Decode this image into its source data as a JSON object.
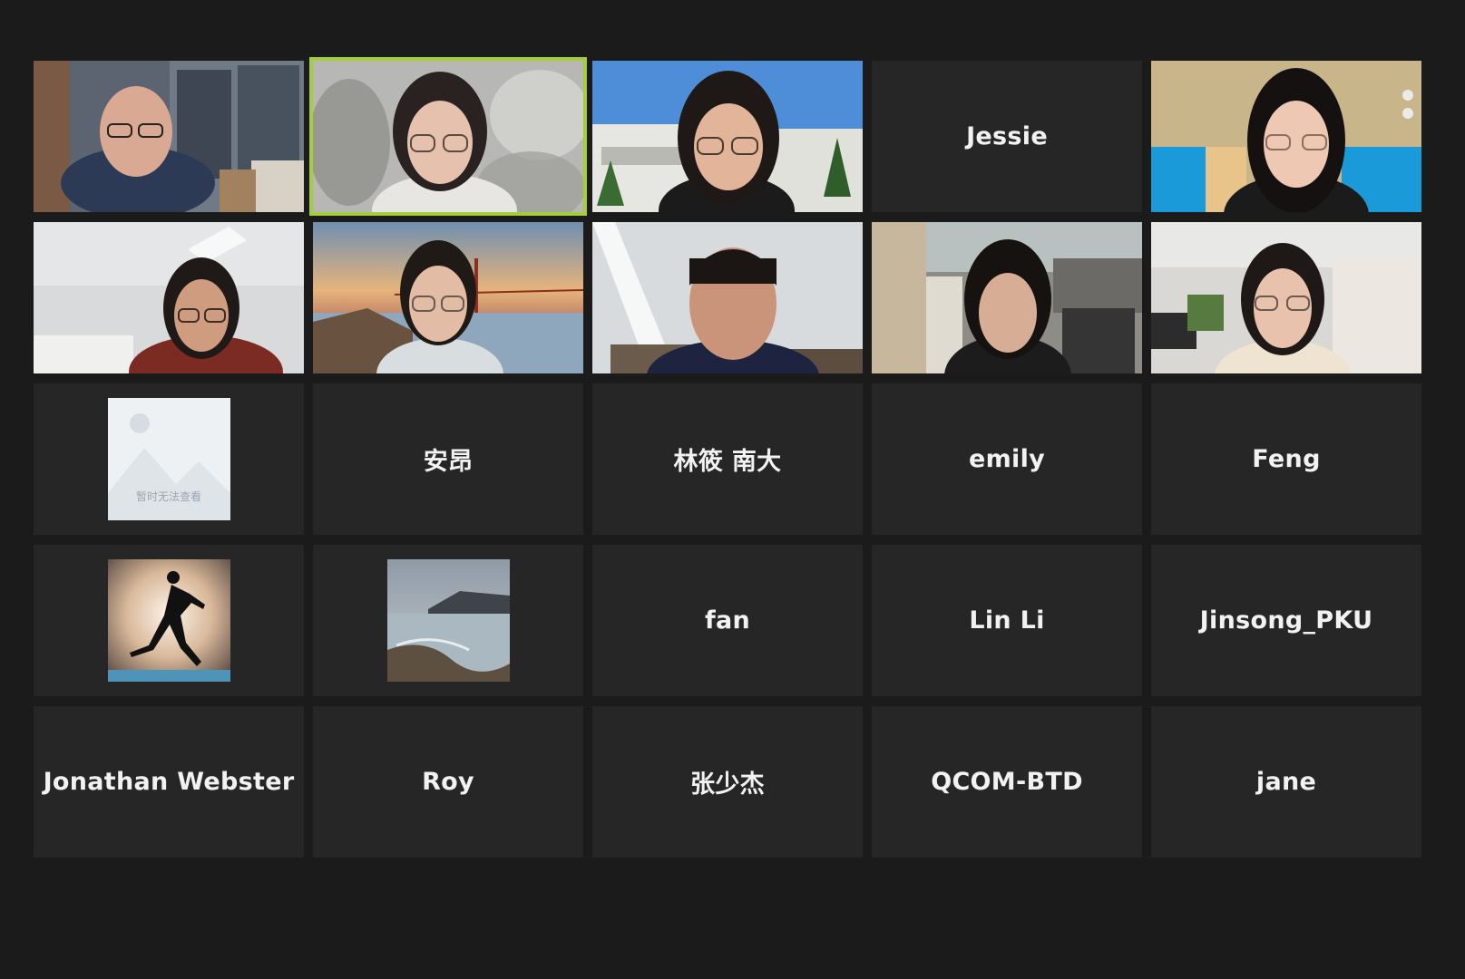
{
  "app": {
    "background": "#1b1b1b",
    "active_speaker_color": "#a4cf3b"
  },
  "participants": [
    {
      "kind": "video",
      "scene": "man-office-bookshelf",
      "active": false
    },
    {
      "kind": "video",
      "scene": "woman-blurred-background",
      "active": true
    },
    {
      "kind": "video",
      "scene": "woman-building-sky",
      "active": false
    },
    {
      "kind": "name",
      "name": "Jessie"
    },
    {
      "kind": "video",
      "scene": "woman-blue-room",
      "active": false
    },
    {
      "kind": "video",
      "scene": "woman-office-ceiling",
      "active": false
    },
    {
      "kind": "video",
      "scene": "woman-bridge-sunset",
      "active": false
    },
    {
      "kind": "video",
      "scene": "man-library",
      "active": false
    },
    {
      "kind": "video",
      "scene": "woman-dorm-room",
      "active": false
    },
    {
      "kind": "video",
      "scene": "woman-open-office",
      "active": false
    },
    {
      "kind": "avatar",
      "avatar": "placeholder-mountain-icon",
      "caption": "暂时无法查看"
    },
    {
      "kind": "name",
      "name": "安昂"
    },
    {
      "kind": "name",
      "name": "林筱 南大"
    },
    {
      "kind": "name",
      "name": "emily"
    },
    {
      "kind": "name",
      "name": "Feng"
    },
    {
      "kind": "avatar",
      "avatar": "runner-silhouette-icon"
    },
    {
      "kind": "avatar",
      "avatar": "seascape-photo-icon"
    },
    {
      "kind": "name",
      "name": "fan"
    },
    {
      "kind": "name",
      "name": "Lin Li"
    },
    {
      "kind": "name",
      "name": "Jinsong_PKU"
    },
    {
      "kind": "name",
      "name": "Jonathan Webster"
    },
    {
      "kind": "name",
      "name": "Roy"
    },
    {
      "kind": "name",
      "name": "张少杰"
    },
    {
      "kind": "name",
      "name": "QCOM-BTD"
    },
    {
      "kind": "name",
      "name": "jane"
    }
  ]
}
